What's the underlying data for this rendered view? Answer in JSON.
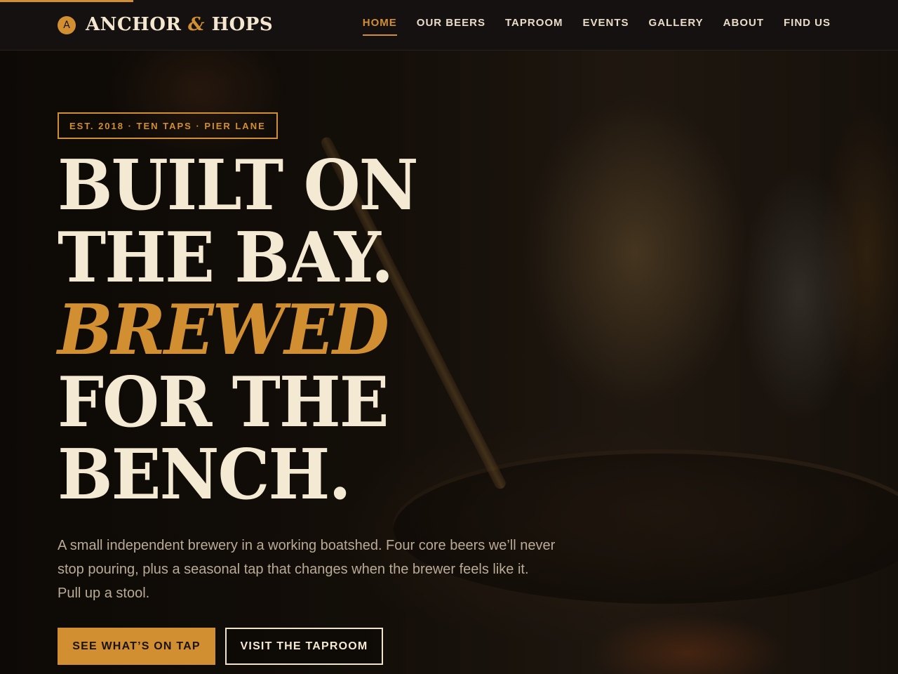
{
  "header": {
    "brand": {
      "badge": "A",
      "name_part1": "ANCHOR",
      "ampersand": "&",
      "name_part2": "HOPS"
    },
    "nav": [
      {
        "label": "HOME",
        "active": true
      },
      {
        "label": "OUR BEERS",
        "active": false
      },
      {
        "label": "TAPROOM",
        "active": false
      },
      {
        "label": "EVENTS",
        "active": false
      },
      {
        "label": "GALLERY",
        "active": false
      },
      {
        "label": "ABOUT",
        "active": false
      },
      {
        "label": "FIND US",
        "active": false
      }
    ]
  },
  "hero": {
    "eyebrow": "EST. 2018 · TEN TAPS · PIER LANE",
    "headline_lines": [
      "BUILT ON",
      "THE BAY.",
      "BREWED",
      "FOR THE",
      "BENCH."
    ],
    "intro": "A small independent brewery in a working boatshed. Four core beers we’ll never stop pouring, plus a seasonal tap that changes when the brewer feels like it. Pull up a stool.",
    "primary_cta": "SEE WHAT’S ON TAP",
    "secondary_cta": "VISIT THE TAPROOM"
  },
  "colors": {
    "accent": "#d18f31",
    "cream": "#f4e9d2",
    "background": "#120d08",
    "muted_text": "#b9ab96"
  }
}
